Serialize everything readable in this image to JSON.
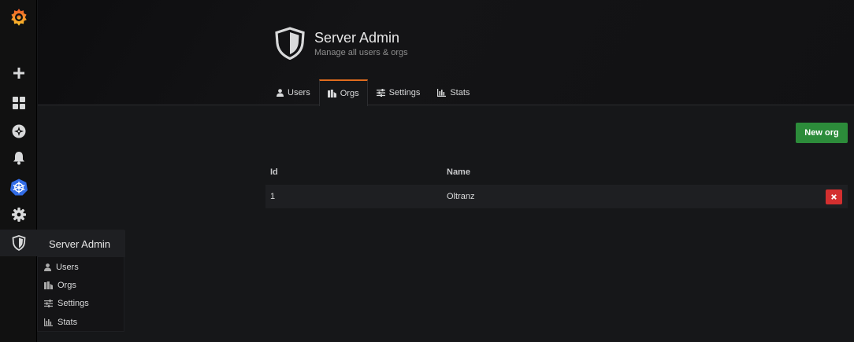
{
  "header": {
    "title": "Server Admin",
    "subtitle": "Manage all users & orgs",
    "icon": "shield-icon"
  },
  "tabs": [
    {
      "label": "Users",
      "icon": "user-icon",
      "active": false
    },
    {
      "label": "Orgs",
      "icon": "building-icon",
      "active": true
    },
    {
      "label": "Settings",
      "icon": "sliders-icon",
      "active": false
    },
    {
      "label": "Stats",
      "icon": "bar-chart-icon",
      "active": false
    }
  ],
  "sidebar": {
    "items": [
      {
        "name": "grafana-logo",
        "icon": "grafana-logo"
      },
      {
        "name": "create",
        "icon": "plus-icon"
      },
      {
        "name": "dashboards",
        "icon": "grid-icon"
      },
      {
        "name": "explore",
        "icon": "compass-icon"
      },
      {
        "name": "alerting",
        "icon": "bell-icon"
      },
      {
        "name": "kubernetes",
        "icon": "kubernetes-icon"
      },
      {
        "name": "configuration",
        "icon": "gear-icon"
      },
      {
        "name": "server-admin",
        "icon": "shield-icon"
      }
    ]
  },
  "flyout": {
    "title": "Server Admin",
    "items": [
      {
        "label": "Users",
        "icon": "user-icon"
      },
      {
        "label": "Orgs",
        "icon": "building-icon"
      },
      {
        "label": "Settings",
        "icon": "sliders-icon"
      },
      {
        "label": "Stats",
        "icon": "bar-chart-icon"
      }
    ]
  },
  "actions": {
    "new_org_label": "New org"
  },
  "table": {
    "columns": [
      "Id",
      "Name"
    ],
    "rows": [
      {
        "id": "1",
        "name": "Oltranz"
      }
    ]
  },
  "colors": {
    "background": "#161719",
    "sidebar": "#111111",
    "accent_tab": "#e06c1e",
    "primary_button": "#2c8c3a",
    "danger_button": "#d32f2f",
    "kubernetes_blue": "#326ce5"
  }
}
